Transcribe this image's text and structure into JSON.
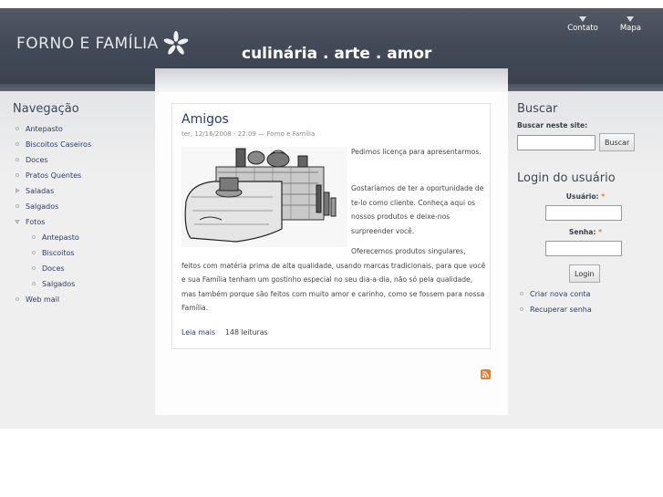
{
  "header": {
    "site_name": "FORNO E FAMÍLIA",
    "slogan": "culinária . arte . amor",
    "links": [
      "Contato",
      "Mapa"
    ]
  },
  "nav": {
    "title": "Navegação",
    "items": [
      {
        "label": "Antepasto",
        "level": 0,
        "marker": "leaf"
      },
      {
        "label": "Biscoitos Caseiros",
        "level": 0,
        "marker": "leaf"
      },
      {
        "label": "Doces",
        "level": 0,
        "marker": "leaf"
      },
      {
        "label": "Pratos Quentes",
        "level": 0,
        "marker": "leaf"
      },
      {
        "label": "Saladas",
        "level": 0,
        "marker": "collapsed"
      },
      {
        "label": "Salgados",
        "level": 0,
        "marker": "leaf"
      },
      {
        "label": "Fotos",
        "level": 0,
        "marker": "expanded"
      },
      {
        "label": "Antepasto",
        "level": 1,
        "marker": "leaf"
      },
      {
        "label": "Biscoitos",
        "level": 1,
        "marker": "leaf"
      },
      {
        "label": "Doces",
        "level": 1,
        "marker": "leaf"
      },
      {
        "label": "Salgados",
        "level": 1,
        "marker": "leaf"
      },
      {
        "label": "Web mail",
        "level": 0,
        "marker": "leaf"
      }
    ]
  },
  "node": {
    "title": "Amigos",
    "meta": "ter, 12/16/2008 - 22:09 — Forno e Família",
    "p1": "Pedimos licença para apresentarmos.",
    "p2": "Gostaríamos de ter a oportunidade de te-lo como cliente. Conheça aqui os nossos produtos e deixe-nos surpreender você.",
    "p3": "Oferecemos produtos singulares, feitos com matéria prima de alta qualidade, usando marcas tradicionais, para que você e sua Família tenham um gostinho especial no seu dia-a-dia, não só pela qualidade, mas também porque são feitos com muito amor e carinho, como se fossem para nossa Família.",
    "read_more": "Leia mais",
    "reads": "148 leituras"
  },
  "search": {
    "title": "Buscar",
    "label": "Buscar neste site:",
    "button": "Buscar",
    "value": ""
  },
  "login": {
    "title": "Login do usuário",
    "user_label": "Usuário:",
    "pass_label": "Senha:",
    "required_mark": "*",
    "button": "Login",
    "links": [
      "Criar nova conta",
      "Recuperar senha"
    ]
  },
  "colors": {
    "header": "#434a57",
    "link": "#2d3d6c",
    "title": "#2a3b6a",
    "rss": "#f07a22"
  }
}
